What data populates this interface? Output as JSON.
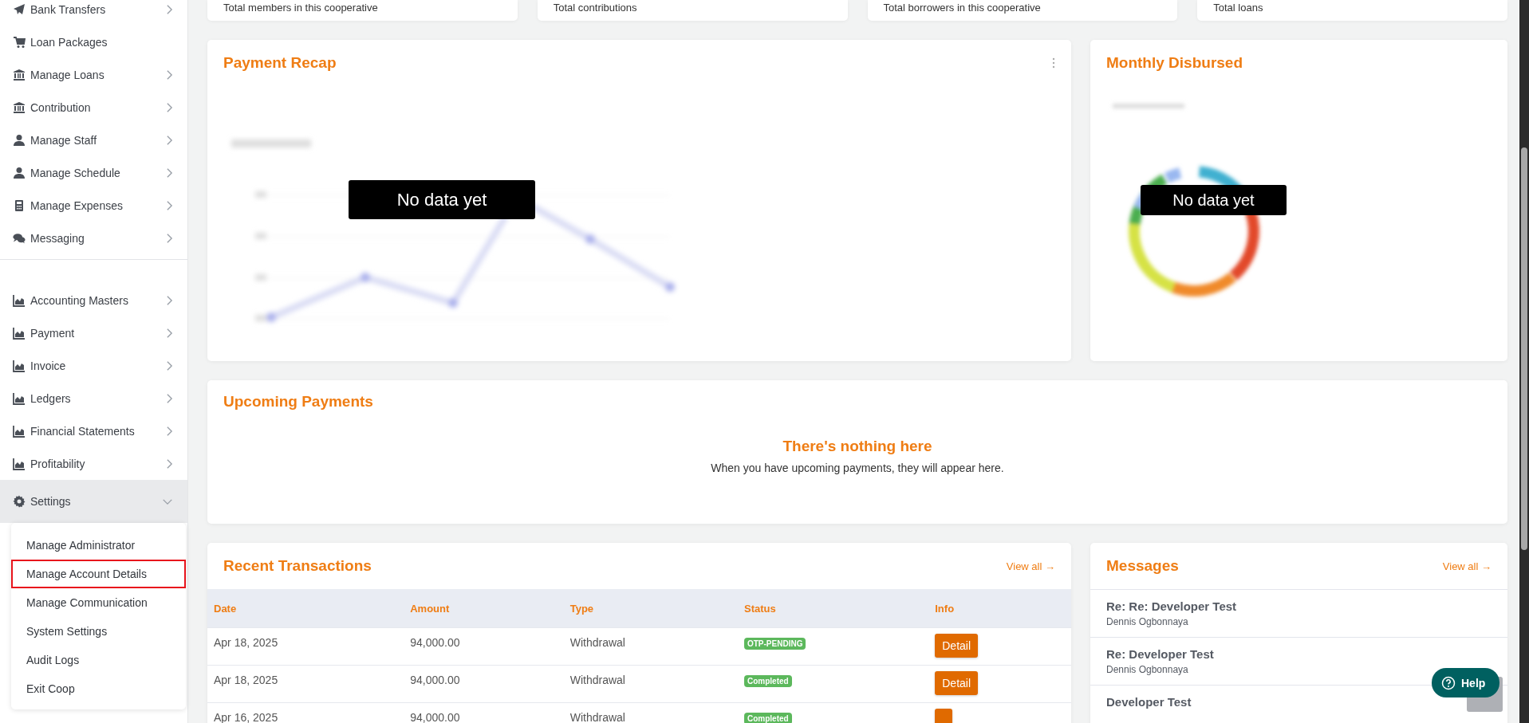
{
  "sidebar": {
    "groups": [
      {
        "items": [
          {
            "label": "Bank Transfers",
            "expandable": true,
            "expanded": false
          },
          {
            "label": "Loan Packages",
            "expandable": false,
            "expanded": false
          },
          {
            "label": "Manage Loans",
            "expandable": true,
            "expanded": false
          },
          {
            "label": "Contribution",
            "expandable": true,
            "expanded": false
          },
          {
            "label": "Manage Staff",
            "expandable": true,
            "expanded": false
          },
          {
            "label": "Manage Schedule",
            "expandable": true,
            "expanded": false
          },
          {
            "label": "Manage Expenses",
            "expandable": true,
            "expanded": false
          },
          {
            "label": "Messaging",
            "expandable": true,
            "expanded": false
          }
        ]
      },
      {
        "items": [
          {
            "label": "Accounting Masters",
            "expandable": true,
            "expanded": false
          },
          {
            "label": "Payment",
            "expandable": true,
            "expanded": false
          },
          {
            "label": "Invoice",
            "expandable": true,
            "expanded": false
          },
          {
            "label": "Ledgers",
            "expandable": true,
            "expanded": false
          },
          {
            "label": "Financial Statements",
            "expandable": true,
            "expanded": false
          },
          {
            "label": "Profitability",
            "expandable": true,
            "expanded": false
          },
          {
            "label": "Settings",
            "expandable": true,
            "expanded": true,
            "children": [
              {
                "label": "Manage Administrator",
                "highlighted": false
              },
              {
                "label": "Manage Account Details",
                "highlighted": true
              },
              {
                "label": "Manage Communication",
                "highlighted": false
              },
              {
                "label": "System Settings",
                "highlighted": false
              },
              {
                "label": "Audit Logs",
                "highlighted": false
              },
              {
                "label": "Exit Coop",
                "highlighted": false
              }
            ]
          }
        ]
      }
    ]
  },
  "stat_cards": [
    {
      "caption": "Total members in this cooperative"
    },
    {
      "caption": "Total contributions"
    },
    {
      "caption": "Total borrowers in this cooperative"
    },
    {
      "caption": "Total loans"
    }
  ],
  "payment_recap": {
    "title": "Payment Recap",
    "overlay": "No data yet"
  },
  "monthly_disbursed": {
    "title": "Monthly Disbursed",
    "overlay": "No data yet"
  },
  "upcoming_payments": {
    "title": "Upcoming Payments",
    "empty_title": "There's nothing here",
    "empty_text": "When you have upcoming payments, they will appear here."
  },
  "recent_transactions": {
    "title": "Recent Transactions",
    "view_all": "View all →",
    "columns": [
      "Date",
      "Amount",
      "Type",
      "Status",
      "Info"
    ],
    "rows": [
      {
        "date": "Apr 18, 2025",
        "amount": "94,000.00",
        "type": "Withdrawal",
        "status": "OTP-PENDING",
        "action": "Detail"
      },
      {
        "date": "Apr 18, 2025",
        "amount": "94,000.00",
        "type": "Withdrawal",
        "status": "Completed",
        "action": "Detail"
      },
      {
        "date": "Apr 16, 2025",
        "amount": "94,000.00",
        "type": "Withdrawal",
        "status": "Completed"
      }
    ]
  },
  "messages": {
    "title": "Messages",
    "view_all": "View all →",
    "items": [
      {
        "subject": "Re: Re: Developer Test",
        "sender": "Dennis Ogbonnaya"
      },
      {
        "subject": "Re: Developer Test",
        "sender": "Dennis Ogbonnaya"
      },
      {
        "subject": "Developer Test"
      }
    ]
  },
  "help_button": {
    "label": "Help"
  }
}
